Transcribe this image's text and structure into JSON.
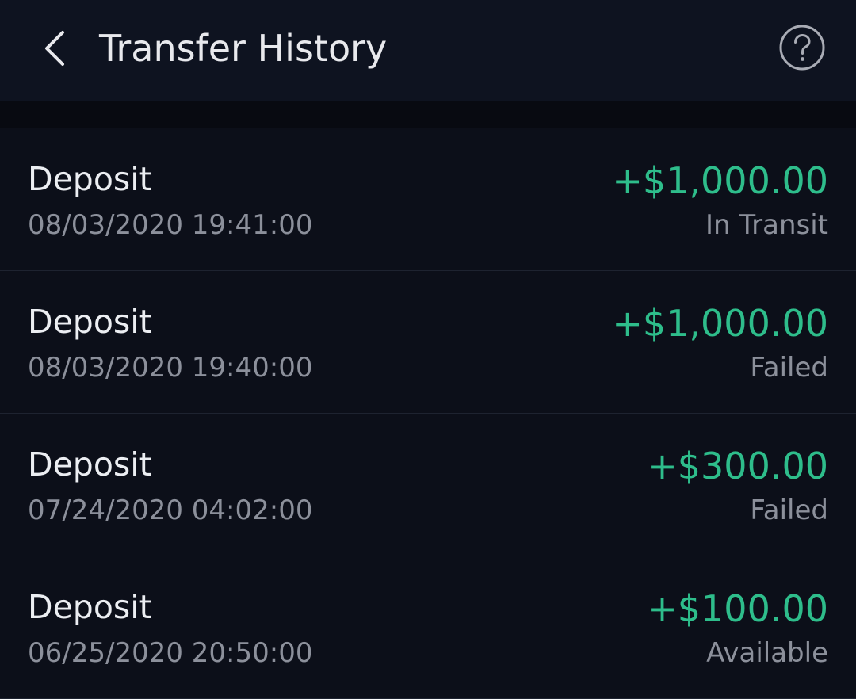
{
  "header": {
    "title": "Transfer History",
    "back_icon": "chevron-left-icon",
    "help_icon": "question-circle-icon"
  },
  "colors": {
    "background": "#0c0f19",
    "header": "#0e1320",
    "amount_positive": "#2ebd8b",
    "secondary_text": "#8c909b"
  },
  "transfers": [
    {
      "type": "Deposit",
      "date": "08/03/2020 19:41:00",
      "amount": "+$1,000.00",
      "status": "In Transit"
    },
    {
      "type": "Deposit",
      "date": "08/03/2020 19:40:00",
      "amount": "+$1,000.00",
      "status": "Failed"
    },
    {
      "type": "Deposit",
      "date": "07/24/2020 04:02:00",
      "amount": "+$300.00",
      "status": "Failed"
    },
    {
      "type": "Deposit",
      "date": "06/25/2020 20:50:00",
      "amount": "+$100.00",
      "status": "Available"
    }
  ]
}
